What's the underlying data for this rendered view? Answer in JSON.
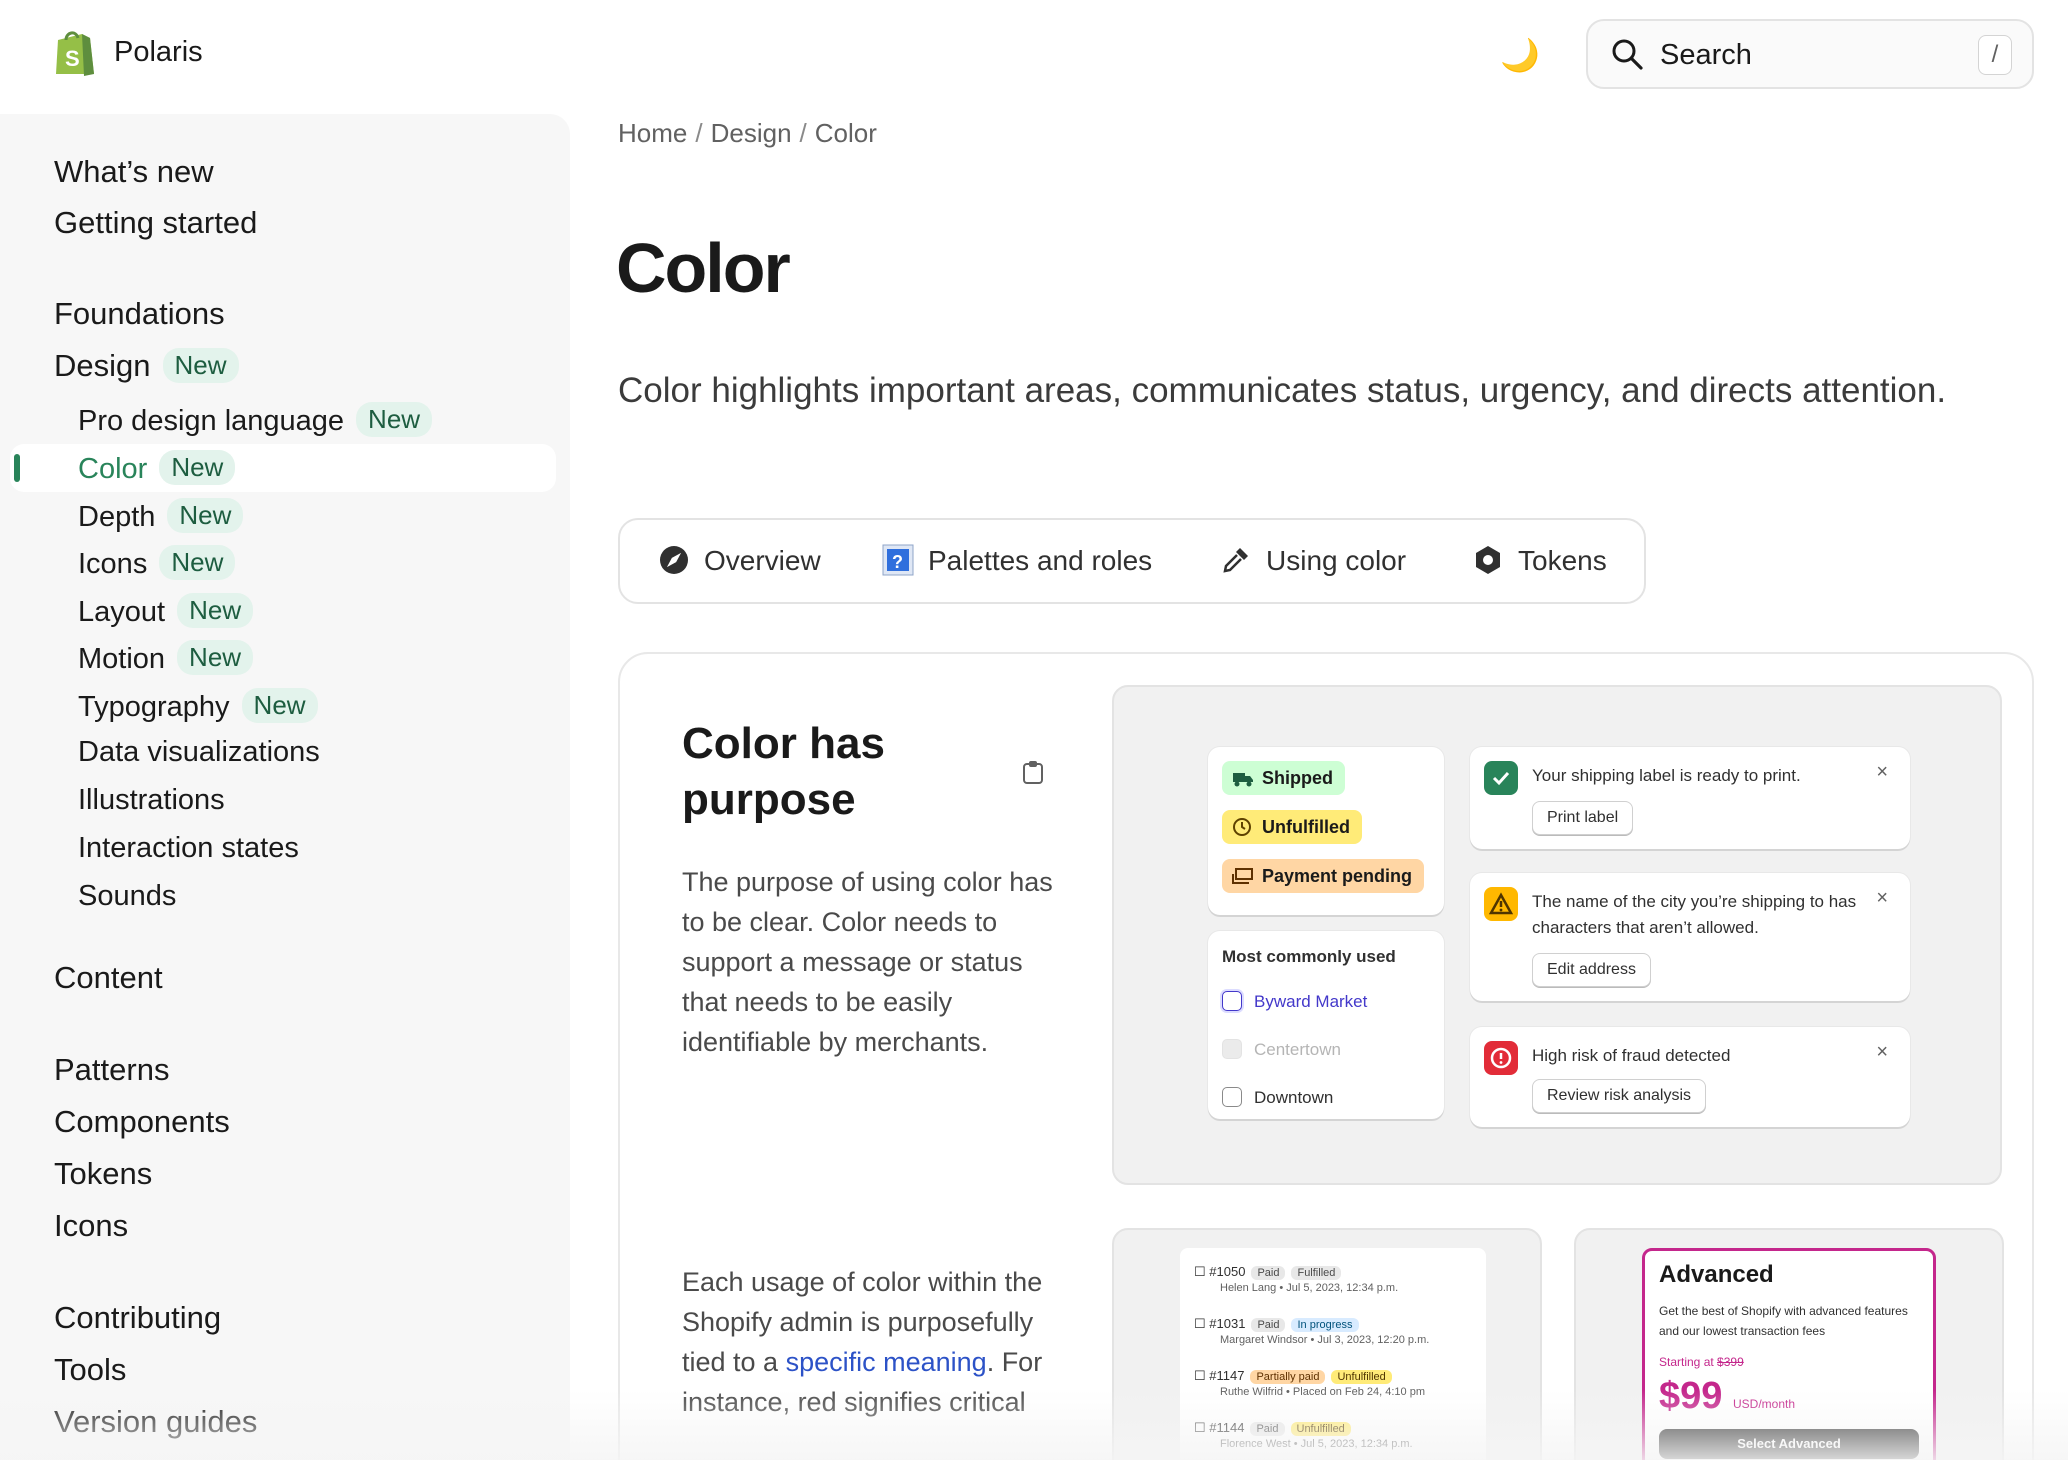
{
  "header": {
    "brand": "Polaris",
    "search_label": "Search",
    "search_shortcut": "/"
  },
  "sidebar": {
    "top": [
      "What’s new",
      "Getting started"
    ],
    "foundations": "Foundations",
    "design": {
      "label": "Design",
      "badge": "New"
    },
    "design_items": [
      {
        "label": "Pro design language",
        "badge": "New"
      },
      {
        "label": "Color",
        "badge": "New",
        "active": true
      },
      {
        "label": "Depth",
        "badge": "New"
      },
      {
        "label": "Icons",
        "badge": "New"
      },
      {
        "label": "Layout",
        "badge": "New"
      },
      {
        "label": "Motion",
        "badge": "New"
      },
      {
        "label": "Typography",
        "badge": "New"
      },
      {
        "label": "Data visualizations"
      },
      {
        "label": "Illustrations"
      },
      {
        "label": "Interaction states"
      },
      {
        "label": "Sounds"
      }
    ],
    "content": "Content",
    "group2": [
      "Patterns",
      "Components",
      "Tokens",
      "Icons"
    ],
    "group3": [
      "Contributing",
      "Tools",
      "Version guides"
    ]
  },
  "breadcrumbs": [
    "Home",
    "Design",
    "Color"
  ],
  "page": {
    "title": "Color",
    "lead": "Color highlights important areas, communicates status, urgency, and directs attention."
  },
  "tabs": [
    "Overview",
    "Palettes and roles",
    "Using color",
    "Tokens"
  ],
  "section": {
    "title": "Color has purpose",
    "para1": "The purpose of using color has to be clear. Color needs to support a message or status that needs to be easily identifiable by merchants.",
    "para2_a": "Each usage of color within the Shopify admin is purposefully tied to a ",
    "para2_link": "specific meaning",
    "para2_b": ". For instance, red signifies critical"
  },
  "demo": {
    "pills": [
      {
        "label": "Shipped",
        "color": "#cdfed4"
      },
      {
        "label": "Unfulfilled",
        "color": "#ffeb78"
      },
      {
        "label": "Payment pending",
        "color": "#ffd6a4"
      }
    ],
    "list_title": "Most commonly used",
    "list_items": [
      "Byward Market",
      "Centertown",
      "Downtown"
    ],
    "notices": [
      {
        "text": "Your shipping label is ready to print.",
        "button": "Print label",
        "tone": "success"
      },
      {
        "text": "The name of the city you’re shipping to has characters that aren’t allowed.",
        "button": "Edit address",
        "tone": "warning"
      },
      {
        "text": "High risk of fraud detected",
        "button": "Review risk analysis",
        "tone": "critical"
      }
    ],
    "close": "×"
  },
  "orders": [
    {
      "id": "#1050",
      "badges": [
        "Paid",
        "Fulfilled"
      ],
      "meta": "Helen Lang • Jul 5, 2023, 12:34 p.m."
    },
    {
      "id": "#1031",
      "badges": [
        "Paid",
        "In progress"
      ],
      "meta": "Margaret Windsor • Jul 3, 2023, 12:20 p.m."
    },
    {
      "id": "#1147",
      "badges": [
        "Partially paid",
        "Unfulfilled"
      ],
      "meta": "Ruthe Wilfrid • Placed on Feb 24, 4:10 pm"
    },
    {
      "id": "#1144",
      "badges": [
        "Paid",
        "Unfulfilled"
      ],
      "meta": "Florence West • Jul 5, 2023, 12:34 p.m."
    }
  ],
  "plan": {
    "title": "Advanced",
    "desc": "Get the best of Shopify with advanced features and our lowest transaction fees",
    "starting": "Starting at",
    "old_price": "$399",
    "price": "$99",
    "unit": "USD/month",
    "button": "Select Advanced"
  },
  "colors": {
    "accent": "#29845a",
    "link": "#2c52c7",
    "magenta": "#c4278c"
  }
}
